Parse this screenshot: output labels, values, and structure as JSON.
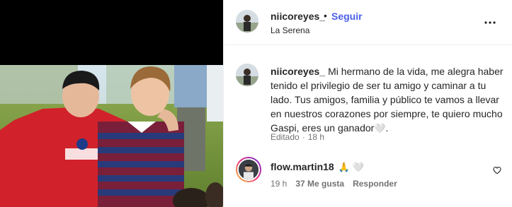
{
  "header": {
    "username": "niicoreyes_",
    "dot": "•",
    "follow_label": "Seguir",
    "location": "La Serena",
    "more_icon": "more-horizontal-icon"
  },
  "caption": {
    "username": "niicoreyes_",
    "text": "Mi hermano de la vida, me alegra haber tenido el privilegio de ser tu amigo y caminar a tu lado. Tus amigos, familia y público te vamos a llevar en nuestros corazones por siempre, te quiero mucho Gaspi, eres un ganador",
    "emoji": "🤍",
    "trailing": ".",
    "edited": "Editado",
    "dot": "·",
    "time": "18 h"
  },
  "comment": {
    "username": "flow.martin18",
    "emoji_1": "🙏",
    "emoji_2": "🤍",
    "time": "19 h",
    "likes": "37 Me gusta",
    "reply_label": "Responder",
    "like_icon": "heart-outline-icon"
  },
  "colors": {
    "accent": "#4a5ee8",
    "text": "#262626",
    "secondary": "#737373",
    "divider": "#efefef"
  }
}
